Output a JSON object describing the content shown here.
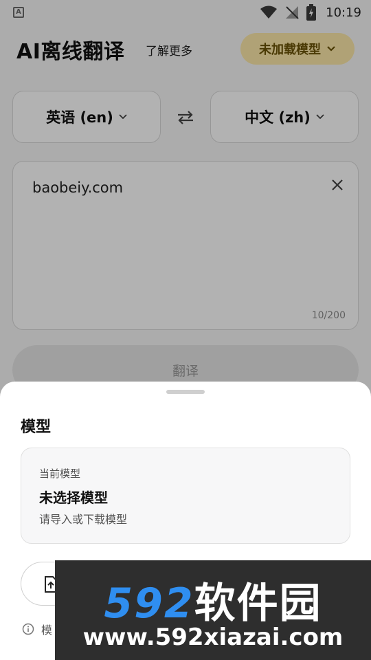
{
  "status_bar": {
    "time": "10:19",
    "app_badge": "A"
  },
  "header": {
    "title": "AI离线翻译",
    "learn_more": "了解更多",
    "model_chip": "未加载模型"
  },
  "languages": {
    "source": "英语 (en)",
    "target": "中文 (zh)"
  },
  "input": {
    "text": "baobeiy.com",
    "char_count": "10/200"
  },
  "translate_button": "翻译",
  "sheet": {
    "title": "模型",
    "card_label": "当前模型",
    "card_value": "未选择模型",
    "card_hint": "请导入或下载模型",
    "info_text": "模"
  },
  "watermark": {
    "digits": "592",
    "cn": "软件园",
    "url": "www.592xiazai.com"
  },
  "colors": {
    "chip_bg": "#fde9a9",
    "chip_text": "#6b5308",
    "watermark_blue": "#2f8ef0"
  }
}
